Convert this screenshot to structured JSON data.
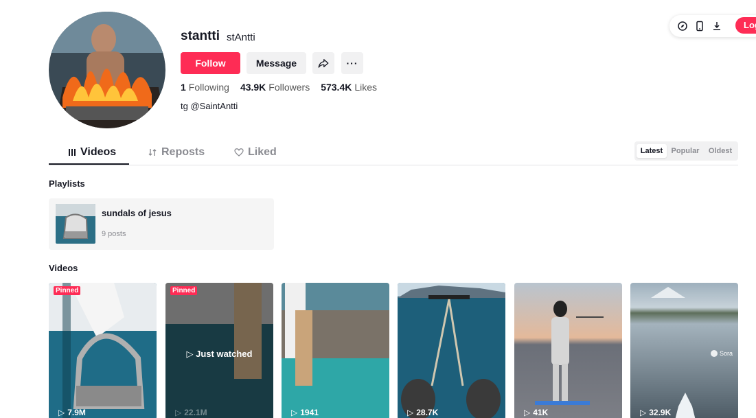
{
  "profile": {
    "username": "stantti",
    "nickname": "stAntti",
    "follow_label": "Follow",
    "message_label": "Message",
    "more_label": "···",
    "stats": [
      {
        "value": "1",
        "label": "Following"
      },
      {
        "value": "43.9K",
        "label": "Followers"
      },
      {
        "value": "573.4K",
        "label": "Likes"
      }
    ],
    "bio": "tg @SaintAntti"
  },
  "toolbar": {
    "icons": [
      "compass-icon",
      "phone-icon",
      "download-icon"
    ],
    "login_label": "Log"
  },
  "tabs": [
    {
      "label": "Videos",
      "icon": "grid-icon",
      "active": true
    },
    {
      "label": "Reposts",
      "icon": "repost-icon",
      "active": false
    },
    {
      "label": "Liked",
      "icon": "heart-icon",
      "active": false
    }
  ],
  "sort": {
    "options": [
      "Latest",
      "Popular",
      "Oldest"
    ],
    "selected": "Latest"
  },
  "playlists": {
    "title": "Playlists",
    "items": [
      {
        "name": "sundals of jesus",
        "count": "9 posts"
      }
    ]
  },
  "videos": {
    "title": "Videos",
    "items": [
      {
        "views": "7.9M",
        "pinned": "Pinned"
      },
      {
        "views": "22.1M",
        "pinned": "Pinned",
        "overlay": "Just watched"
      },
      {
        "views": "1941"
      },
      {
        "views": "28.7K"
      },
      {
        "views": "41K"
      },
      {
        "views": "32.9K",
        "badge": "Sora"
      }
    ]
  },
  "colors": {
    "accent": "#fe2c55",
    "text": "#161823",
    "muted": "#8a8b91",
    "button_bg": "#f1f1f2"
  }
}
